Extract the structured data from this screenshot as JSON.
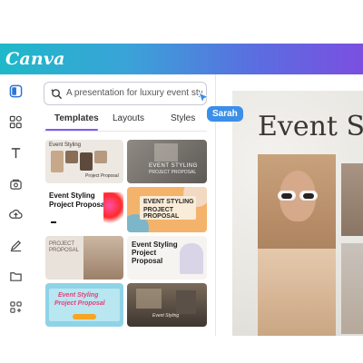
{
  "app": {
    "logo_text": "Canva"
  },
  "sidenav": {
    "items": [
      {
        "icon": "layout-icon"
      },
      {
        "icon": "elements-icon"
      },
      {
        "icon": "text-icon"
      },
      {
        "icon": "brand-icon"
      },
      {
        "icon": "upload-icon"
      },
      {
        "icon": "draw-icon"
      },
      {
        "icon": "folder-icon"
      },
      {
        "icon": "apps-icon"
      }
    ]
  },
  "search": {
    "value": "A presentation for luxury event styling"
  },
  "tabs": [
    {
      "label": "Templates",
      "active": true
    },
    {
      "label": "Layouts",
      "active": false
    },
    {
      "label": "Styles",
      "active": false
    }
  ],
  "collaborator": {
    "name": "Sarah",
    "color": "#3b8fe8"
  },
  "templates": [
    {
      "title_line1": "Event Styling",
      "subtitle": "Project Proposal"
    },
    {
      "title_line1": "EVENT STYLING",
      "subtitle": "PROJECT PROPOSAL"
    },
    {
      "title_line1": "Event Styling",
      "title_line2": "Project Proposal"
    },
    {
      "title_line1": "EVENT STYLING",
      "title_line2": "PROJECT PROPOSAL"
    },
    {
      "title_line1": "PROJECT",
      "title_line2": "PROPOSAL"
    },
    {
      "title_line1": "Event Styling",
      "title_line2": "Project",
      "title_line3": "Proposal"
    },
    {
      "title_line1": "Event Styling",
      "title_line2": "Project Proposal"
    },
    {
      "title_line1": "Event Styling"
    }
  ],
  "document": {
    "title": "Event St"
  },
  "colors": {
    "accent": "#7d5cf0",
    "topbar_start": "#1fb8c9",
    "topbar_end": "#7b4fe0"
  }
}
